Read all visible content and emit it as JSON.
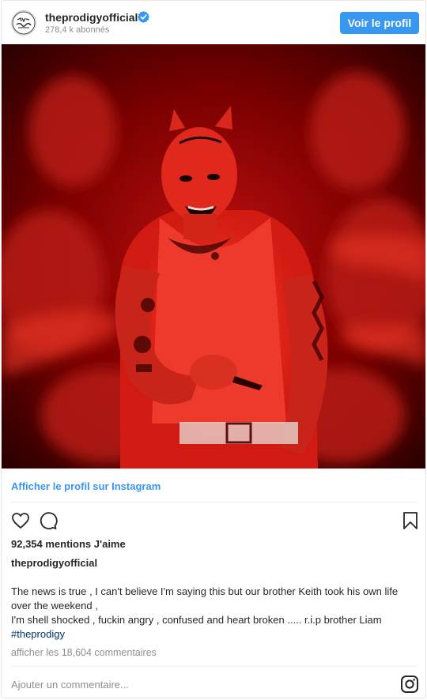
{
  "header": {
    "username": "theprodigyofficial",
    "followers": "278,4 k abonnés",
    "profile_button": "Voir le profil",
    "avatar_text": "THE PRODIGY"
  },
  "media": {
    "icon": "photo"
  },
  "view_profile_link": "Afficher le profil sur Instagram",
  "actions": {
    "like_icon": "heart-icon",
    "comment_icon": "comment-icon",
    "save_icon": "bookmark-icon"
  },
  "likes": "92,354 mentions J'aime",
  "caption": {
    "username": "theprodigyofficial",
    "line1": "The news is true , I can't believe I'm saying this but our brother Keith took his own life over the weekend ,",
    "line2": "I'm shell shocked , fuckin angry , confused and heart broken ..... r.i.p brother Liam",
    "hashtag": "#theprodigy"
  },
  "comments_link": "afficher les 18,604 commentaires",
  "comment_input": {
    "placeholder": "Ajouter un commentaire..."
  },
  "colors": {
    "accent": "#3897f0",
    "hashtag": "#003569",
    "muted": "#8e8e8e"
  }
}
